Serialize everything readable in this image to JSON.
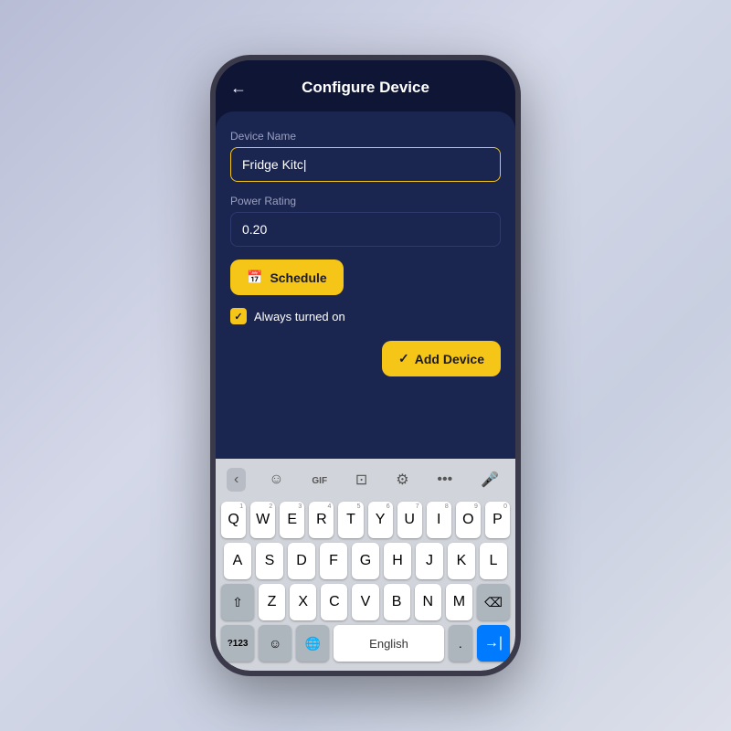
{
  "app": {
    "title": "Configure Device",
    "back_label": "←"
  },
  "form": {
    "device_name_label": "Device Name",
    "device_name_value": "Fridge Kitc|",
    "power_rating_label": "Power Rating",
    "power_rating_value": "0.20",
    "schedule_label": "Schedule",
    "always_on_label": "Always turned on",
    "add_device_label": "Add Device",
    "checkmark": "✓"
  },
  "keyboard": {
    "toolbar": {
      "back": "‹",
      "emoji_picker": "☺",
      "gif": "GIF",
      "clipboard": "⊡",
      "settings": "⚙",
      "more": "•••",
      "mic": "🎤"
    },
    "rows": {
      "row1": [
        "Q",
        "W",
        "E",
        "R",
        "T",
        "Y",
        "U",
        "I",
        "O",
        "P"
      ],
      "row1_nums": [
        "1",
        "2",
        "3",
        "4",
        "5",
        "6",
        "7",
        "8",
        "9",
        "0"
      ],
      "row2": [
        "A",
        "S",
        "D",
        "F",
        "G",
        "H",
        "J",
        "K",
        "L"
      ],
      "row3": [
        "Z",
        "X",
        "C",
        "V",
        "B",
        "N",
        "M"
      ],
      "bottom": {
        "nums": "?123",
        "emoji": "☺",
        "globe": "🌐",
        "space": "English",
        "period": ".",
        "return": "→|"
      }
    }
  },
  "colors": {
    "accent": "#f5c518",
    "bg_dark": "#0f1535",
    "bg_card": "#1a2550",
    "return_blue": "#007AFF"
  }
}
